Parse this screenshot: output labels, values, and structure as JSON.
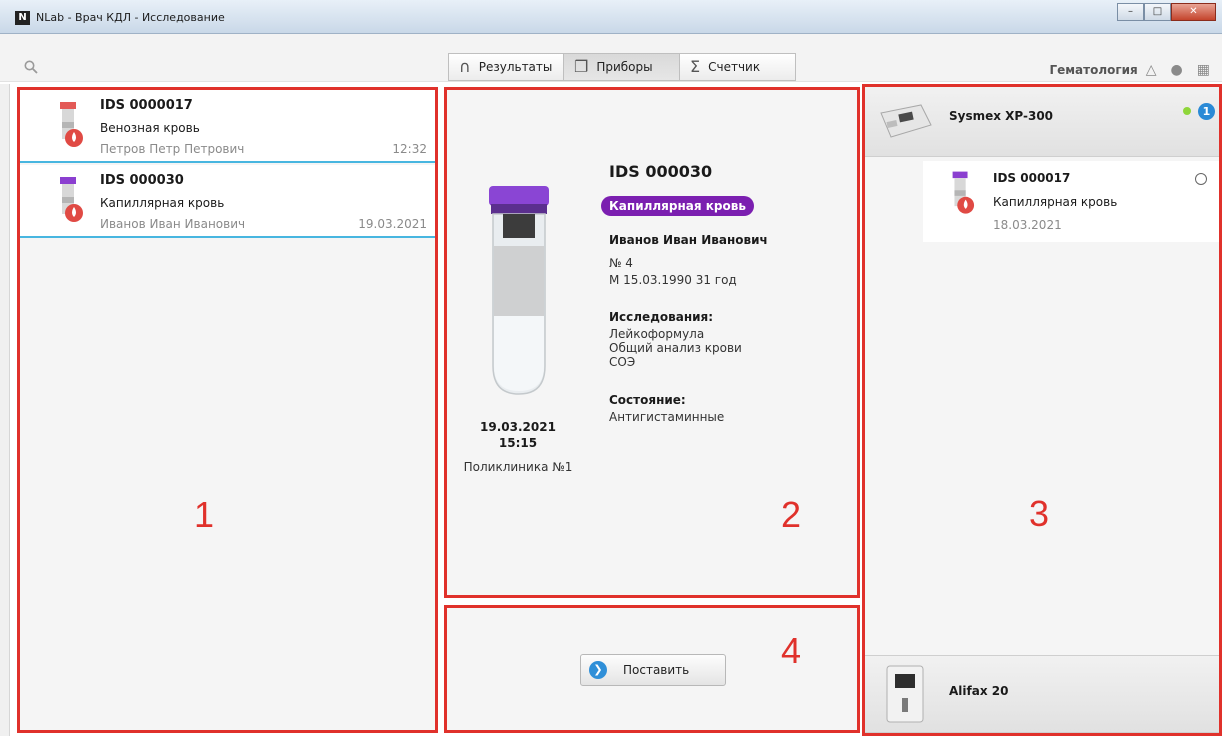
{
  "window": {
    "logo": "N",
    "title": "NLab - Врач КДЛ - Исследование"
  },
  "toolbar": {
    "tabs": [
      {
        "label": "Результаты",
        "icon": "tube-icon"
      },
      {
        "label": "Приборы",
        "icon": "devices-icon"
      },
      {
        "label": "Счетчик",
        "icon": "sigma-icon"
      }
    ],
    "active_tab": "Приборы",
    "department": "Гематология"
  },
  "samples": [
    {
      "id": "IDS 0000017",
      "type": "Венозная кровь",
      "patient": "Петров Петр Петрович",
      "time": "12:32",
      "cap_color": "#e35a57"
    },
    {
      "id": "IDS 000030",
      "type": "Капиллярная кровь",
      "patient": "Иванов Иван Иванович",
      "time": "19.03.2021",
      "cap_color": "#8b3fd0"
    }
  ],
  "details": {
    "id": "IDS 000030",
    "sample_type": "Капиллярная кровь",
    "patient": "Иванов Иван Иванович",
    "number": "№ 4",
    "birth": "М 15.03.1990 31 год",
    "studies_header": "Исследования:",
    "studies": [
      "Лейкоформула",
      "Общий анализ крови",
      "СОЭ"
    ],
    "state_header": "Состояние:",
    "state": "Антигистаминные",
    "date": "19.03.2021",
    "time": "15:15",
    "place": "Поликлиника №1"
  },
  "actions": {
    "post_label": "Поставить"
  },
  "devices": [
    {
      "name": "Sysmex XP-300",
      "status": "online",
      "queue_count": "1"
    },
    {
      "name": "Alifax 20"
    }
  ],
  "device_queue": {
    "id": "IDS 000017",
    "type": "Капиллярная кровь",
    "date": "18.03.2021"
  },
  "annotations": {
    "panel_1": "1",
    "panel_2": "2",
    "panel_3": "3",
    "panel_4": "4"
  },
  "colors": {
    "highlight": "#e0312b",
    "accent": "#48b6e0",
    "badge": "#7b1fb0"
  }
}
